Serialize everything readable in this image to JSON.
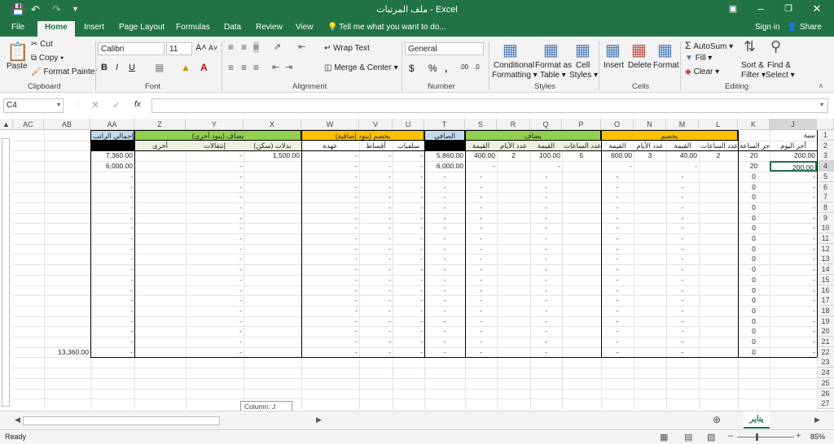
{
  "window": {
    "title": "ملف المرتبات - Excel",
    "signin": "Sign in",
    "share": "Share"
  },
  "tabs": [
    "File",
    "Home",
    "Insert",
    "Page Layout",
    "Formulas",
    "Data",
    "Review",
    "View"
  ],
  "tell_me": "Tell me what you want to do...",
  "clipboard": {
    "paste": "Paste",
    "cut": "Cut",
    "copy": "Copy",
    "format_painter": "Format Painter",
    "label": "Clipboard"
  },
  "font": {
    "name": "Calibri",
    "size": "11",
    "bold": "B",
    "italic": "I",
    "underline": "U",
    "label": "Font"
  },
  "alignment": {
    "wrap": "Wrap Text",
    "merge": "Merge & Center",
    "label": "Alignment"
  },
  "number": {
    "format": "General",
    "currency": "$",
    "percent": "%",
    "comma": ",",
    "label": "Number"
  },
  "styles": {
    "conditional": "Conditional",
    "conditional2": "Formatting",
    "format_as": "Format as",
    "format_as2": "Table",
    "cell": "Cell",
    "cell2": "Styles",
    "label": "Styles"
  },
  "cells": {
    "insert": "Insert",
    "delete": "Delete",
    "format": "Format",
    "label": "Cells"
  },
  "editing": {
    "autosum": "AutoSum",
    "fill": "Fill",
    "clear": "Clear",
    "sort": "Sort &",
    "sort2": "Filter",
    "find": "Find &",
    "find2": "Select",
    "label": "Editing"
  },
  "formula_bar": {
    "name_box": "C4",
    "fx": "fx",
    "value": ""
  },
  "grid": {
    "columns": [
      "AC",
      "AB",
      "AA",
      "Z",
      "Y",
      "X",
      "W",
      "V",
      "U",
      "T",
      "S",
      "R",
      "Q",
      "P",
      "O",
      "N",
      "M",
      "L",
      "K",
      "J"
    ],
    "row_numbers": [
      "1",
      "2",
      "3",
      "4",
      "5",
      "6",
      "7",
      "8",
      "9",
      "10",
      "11",
      "12",
      "13",
      "14",
      "15",
      "16",
      "17",
      "18",
      "19",
      "20",
      "21",
      "22",
      "23",
      "24",
      "25",
      "26",
      "27"
    ],
    "row1": {
      "aa": "إجمالي الراتب",
      "zy": "يضاف (بنود أخرى)",
      "wu": "يخصم (بنود إضافية)",
      "t": "الصافي",
      "sp": "يضاف",
      "ol": "يخصم",
      "j": "سية"
    },
    "row2": {
      "z": "أخرى",
      "y": "إنتقالات",
      "x": "بدلات (سكن)",
      "w": "عهدة",
      "v": "أقساط",
      "u": "سلفيات",
      "s": "القيمة",
      "r": "عدد الأيام",
      "q": "القيمة",
      "p": "عدد الساعات",
      "o": "القيمة",
      "n": "عدد الأيام",
      "m": "القيمة",
      "l": "عدد الساعات",
      "k": "أجر الساعة",
      "j": "أجر اليوم"
    },
    "row3": {
      "aa": "7,360.00",
      "y": "-",
      "x": "1,500.00",
      "w": "-",
      "v": "-",
      "u": "-",
      "t": "5,860.00",
      "s": "400.00",
      "r": "2",
      "q": "100.00",
      "p": "5",
      "o": "600.00",
      "n": "3",
      "m": "40.00",
      "l": "2",
      "k": "20",
      "j": "200.00"
    },
    "row4": {
      "aa": "6,000.00",
      "y": "-",
      "w": "-",
      "v": "-",
      "u": "-",
      "t": "6,000.00",
      "s": "-",
      "q": "-",
      "o": "-",
      "m": "-",
      "k": "20",
      "j": "200.00"
    },
    "dash": "-",
    "zero": "0",
    "total_ab": "13,360.00",
    "tooltip": "Column: J"
  },
  "sheet_tab": "يناير",
  "status": {
    "ready": "Ready",
    "zoom": "85%"
  },
  "colors": {
    "green_header": "#92d050",
    "orange_header": "#ffc000",
    "blue_header": "#c5d9f1",
    "black_cell": "#000000",
    "excel_green": "#217346"
  }
}
